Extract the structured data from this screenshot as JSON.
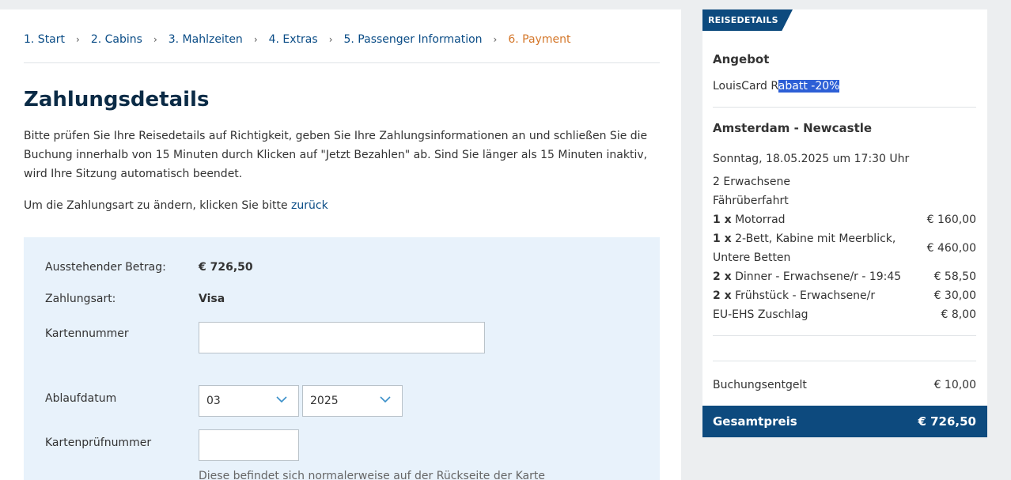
{
  "breadcrumb": {
    "steps": [
      "1. Start",
      "2. Cabins",
      "3. Mahlzeiten",
      "4. Extras",
      "5. Passenger Information",
      "6. Payment"
    ]
  },
  "page": {
    "title": "Zahlungsdetails",
    "intro": "Bitte prüfen Sie Ihre Reisedetails auf Richtigkeit, geben Sie Ihre Zahlungsinformationen an und schließen Sie die Buchung innerhalb von 15 Minuten durch Klicken auf \"Jetzt Bezahlen\" ab. Sind Sie länger als 15 Minuten inaktiv, wird Ihre Sitzung automatisch beendet.",
    "change_prefix": "Um die Zahlungsart zu ändern, klicken Sie bitte ",
    "change_link": "zurück"
  },
  "payment": {
    "amount_label": "Ausstehender Betrag:",
    "amount_value": "€ 726,50",
    "method_label": "Zahlungsart:",
    "method_value": "Visa",
    "card_number_label": "Kartennummer",
    "card_number_value": "",
    "expiry_label": "Ablaufdatum",
    "expiry_month": "03",
    "expiry_year": "2025",
    "cvc_label": "Kartenprüfnummer",
    "cvc_value": "",
    "cvc_hint": "Diese befindet sich normalerweise auf der Rückseite der Karte"
  },
  "sidebar": {
    "tag": "REISEDETAILS",
    "offer_heading": "Angebot",
    "offer_prefix": "LouisCard R",
    "offer_selected": "abatt -20%",
    "route": "Amsterdam - Newcastle",
    "departure": "Sonntag, 18.05.2025 um 17:30 Uhr",
    "passengers": "2 Erwachsene",
    "crossing": "Fährüberfahrt",
    "items": [
      {
        "qty": "1 x",
        "desc": " Motorrad",
        "price": "€ 160,00"
      },
      {
        "qty": "1 x",
        "desc": " 2-Bett, Kabine mit Meerblick, Untere Betten",
        "price": "€ 460,00"
      },
      {
        "qty": "2 x",
        "desc": " Dinner - Erwachsene/r - 19:45",
        "price": "€ 58,50"
      },
      {
        "qty": "2 x",
        "desc": " Frühstück - Erwachsene/r",
        "price": "€ 30,00"
      },
      {
        "qty": "",
        "desc": "EU-EHS Zuschlag",
        "price": "€ 8,00"
      }
    ],
    "booking_fee_label": "Buchungsentgelt",
    "booking_fee_value": "€ 10,00",
    "total_label": "Gesamtpreis",
    "total_value": "€ 726,50"
  },
  "colors": {
    "brand": "#0d4a7e",
    "active_step": "#d4772a",
    "link": "#0a4c86",
    "payment_bg": "#e8f2fb",
    "selection": "#2d5fd6"
  }
}
